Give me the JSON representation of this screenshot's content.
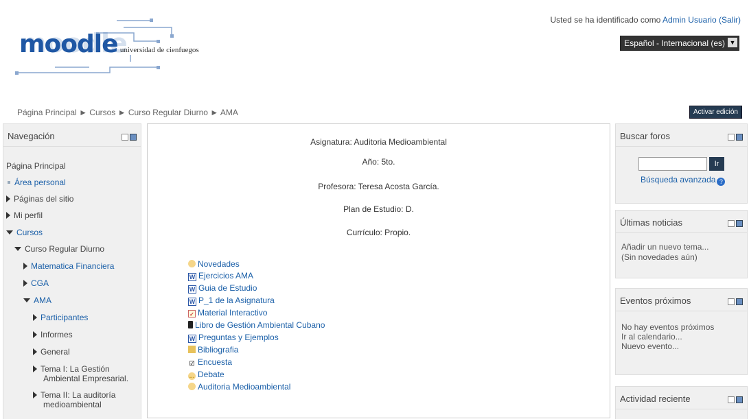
{
  "header": {
    "logo_text": "moodle",
    "logo_sub": "universidad de cienfuegos",
    "login_prefix": "Usted se ha identificado como ",
    "login_user": "Admin Usuario",
    "logout": "(Salir)",
    "language": "Español - Internacional (es)"
  },
  "navbar": {
    "crumbs": [
      "Página Principal",
      "Cursos",
      "Curso Regular Diurno",
      "AMA"
    ],
    "separator": "►",
    "edit_button": "Activar edición"
  },
  "navigation": {
    "title": "Navegación",
    "items": [
      {
        "label": "Página Principal"
      },
      {
        "label": "Área personal"
      },
      {
        "label": "Páginas del sitio"
      },
      {
        "label": "Mi perfil"
      },
      {
        "label": "Cursos"
      },
      {
        "label": "Curso Regular Diurno"
      },
      {
        "label": "Matematica Financiera"
      },
      {
        "label": "CGA"
      },
      {
        "label": "AMA"
      },
      {
        "label": "Participantes"
      },
      {
        "label": "Informes"
      },
      {
        "label": "General"
      },
      {
        "label": "Tema I: La Gestión"
      },
      {
        "label": "Ambiental Empresarial."
      },
      {
        "label": "Tema II: La auditoría"
      },
      {
        "label": "medioambiental"
      }
    ]
  },
  "main": {
    "lines": [
      "Asignatura: Auditoria Medioambiental",
      "Año: 5to.",
      "Profesora: Teresa Acosta García.",
      "Plan de Estudio: D.",
      "Currículo: Propio."
    ],
    "resources": [
      {
        "label": "Novedades",
        "icon": "forum-icon"
      },
      {
        "label": "Ejercicios AMA",
        "icon": "word-icon"
      },
      {
        "label": "Guia de Estudio",
        "icon": "word-icon"
      },
      {
        "label": "P_1 de la Asignatura",
        "icon": "word-icon"
      },
      {
        "label": "Material Interactivo",
        "icon": "scorm-icon"
      },
      {
        "label": "Libro de Gestión Ambiental Cubano",
        "icon": "book-icon"
      },
      {
        "label": "Preguntas y Ejemplos",
        "icon": "word-icon"
      },
      {
        "label": "Bibliografia",
        "icon": "folder-icon"
      },
      {
        "label": "Encuesta",
        "icon": "survey-icon"
      },
      {
        "label": "Debate",
        "icon": "chat-icon"
      },
      {
        "label": "Auditoria Medioambiental",
        "icon": "forum-icon"
      }
    ]
  },
  "search": {
    "title": "Buscar foros",
    "go": "Ir",
    "advanced": "Búsqueda avanzada",
    "help": "?"
  },
  "news": {
    "title": "Últimas noticias",
    "add": "Añadir un nuevo tema...",
    "none": "(Sin novedades aún)"
  },
  "events": {
    "title": "Eventos próximos",
    "none": "No hay eventos próximos",
    "calendar": "Ir al calendario...",
    "new": "Nuevo evento..."
  },
  "activity": {
    "title": "Actividad reciente"
  }
}
